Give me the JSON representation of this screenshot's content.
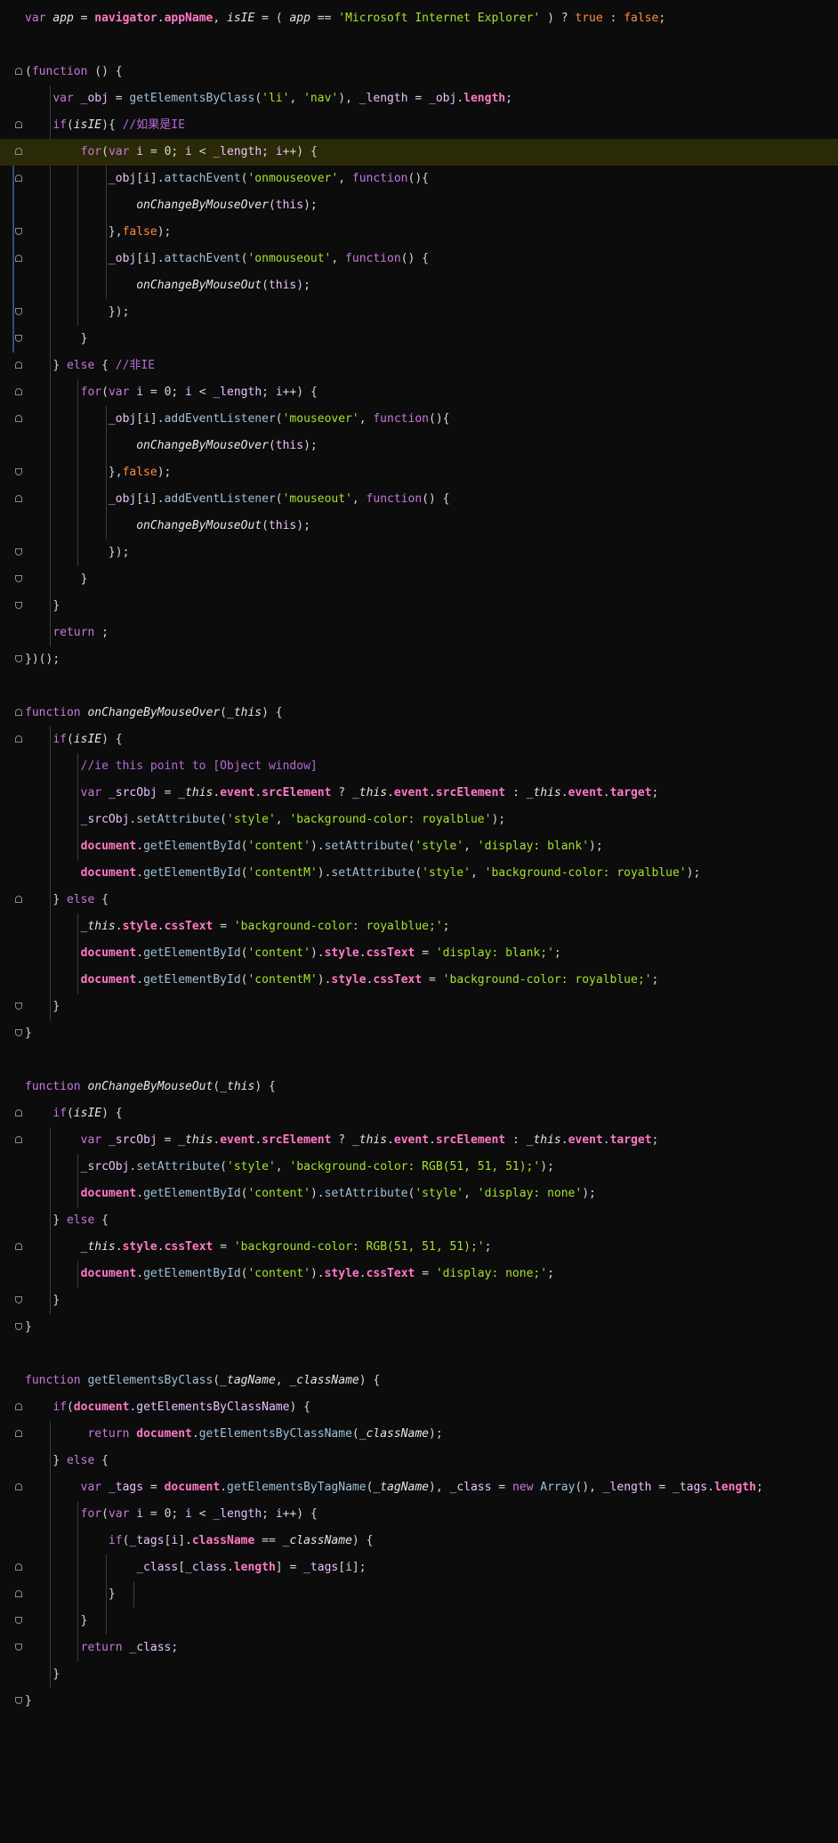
{
  "editor": {
    "lines": [
      "var app = navigator.appName, isIE = ( app == 'Microsoft Internet Explorer' ) ? true : false;",
      "",
      "(function () {",
      "    var _obj = getElementsByClass('li', 'nav'), _length = _obj.length;",
      "    if(isIE){ //如果是IE",
      "        for(var i = 0; i < _length; i++) {",
      "            _obj[i].attachEvent('onmouseover', function(){",
      "                onChangeByMouseOver(this);",
      "            },false);",
      "            _obj[i].attachEvent('onmouseout', function() {",
      "                onChangeByMouseOut(this);",
      "            });",
      "        }",
      "    } else { //非IE",
      "        for(var i = 0; i < _length; i++) {",
      "            _obj[i].addEventListener('mouseover', function(){",
      "                onChangeByMouseOver(this);",
      "            },false);",
      "            _obj[i].addEventListener('mouseout', function() {",
      "                onChangeByMouseOut(this);",
      "            });",
      "        }",
      "    }",
      "    return ;",
      "})();",
      "",
      "function onChangeByMouseOver(_this) {",
      "    if(isIE) {",
      "        //ie this point to [Object window]",
      "        var _srcObj = _this.event.srcElement ? _this.event.srcElement : _this.event.target;",
      "        _srcObj.setAttribute('style', 'background-color: royalblue');",
      "        document.getElementById('content').setAttribute('style', 'display: blank');",
      "        document.getElementById('contentM').setAttribute('style', 'background-color: royalblue');",
      "    } else {",
      "        _this.style.cssText = 'background-color: royalblue;';",
      "        document.getElementById('content').style.cssText = 'display: blank;';",
      "        document.getElementById('contentM').style.cssText = 'background-color: royalblue;';",
      "    }",
      "}",
      "",
      "function onChangeByMouseOut(_this) {",
      "    if(isIE) {",
      "        var _srcObj = _this.event.srcElement ? _this.event.srcElement : _this.event.target;",
      "        _srcObj.setAttribute('style', 'background-color: RGB(51, 51, 51);');",
      "        document.getElementById('content').setAttribute('style', 'display: none');",
      "    } else {",
      "        _this.style.cssText = 'background-color: RGB(51, 51, 51);';",
      "        document.getElementById('content').style.cssText = 'display: none;';",
      "    }",
      "}",
      "",
      "function getElementsByClass(_tagName, _className) {",
      "    if(document.getElementsByClassName) {",
      "         return document.getElementsByClassName(_className);",
      "    } else {",
      "        var _tags = document.getElementsByTagName(_tagName), _class = new Array(), _length = _tags.length;",
      "        for(var i = 0; i < _length; i++) {",
      "            if(_tags[i].className == _className) {",
      "                _class[_class.length] = _tags[i];",
      "            }",
      "        }",
      "        return _class;",
      "    }",
      "}"
    ]
  }
}
